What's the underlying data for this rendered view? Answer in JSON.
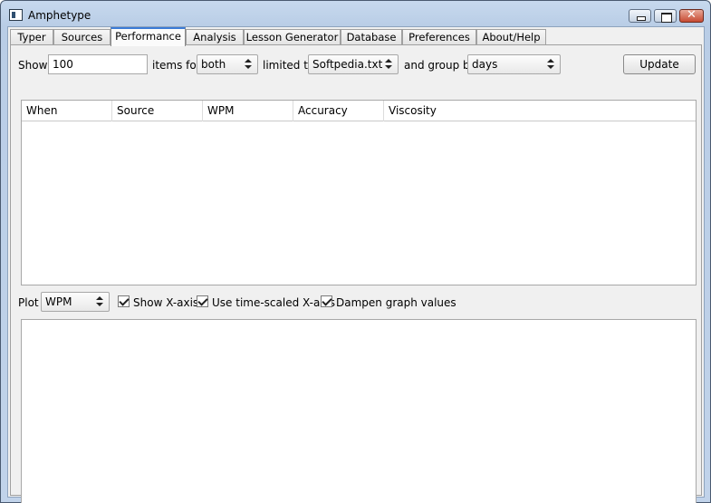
{
  "window": {
    "title": "Amphetype"
  },
  "tabs": [
    {
      "label": "Typer"
    },
    {
      "label": "Sources"
    },
    {
      "label": "Performance"
    },
    {
      "label": "Analysis"
    },
    {
      "label": "Lesson Generator"
    },
    {
      "label": "Database"
    },
    {
      "label": "Preferences"
    },
    {
      "label": "About/Help"
    }
  ],
  "active_tab": "Performance",
  "controls": {
    "show_label": "Show",
    "count_value": "100",
    "items_for_label": "items for",
    "items_for_value": "both",
    "limited_to_label": "limited to",
    "limited_to_value": "Softpedia.txt",
    "group_by_label": "and group by",
    "group_by_value": "days",
    "update_label": "Update"
  },
  "table": {
    "columns": [
      "When",
      "Source",
      "WPM",
      "Accuracy",
      "Viscosity"
    ],
    "rows": []
  },
  "plot": {
    "label": "Plot",
    "value": "WPM",
    "show_x_axis": {
      "label": "Show X-axis",
      "checked": true
    },
    "time_scaled": {
      "label": "Use time-scaled X-axis",
      "checked": true
    },
    "dampen": {
      "label": "Dampen graph values",
      "checked": true
    }
  }
}
